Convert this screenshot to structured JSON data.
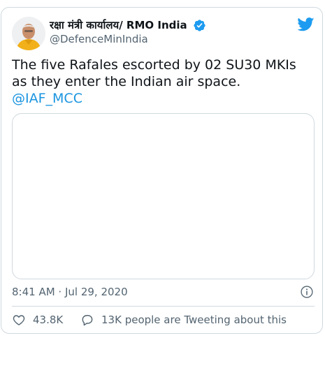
{
  "author": {
    "display_name": "रक्षा मंत्री कार्यालय/ RMO India",
    "handle": "@DefenceMinIndia",
    "verified": true
  },
  "tweet": {
    "text": "The five Rafales escorted by 02 SU30 MKIs as they enter the Indian air space.",
    "mention": "@IAF_MCC"
  },
  "meta": {
    "timestamp": "8:41 AM · Jul 29, 2020"
  },
  "actions": {
    "like_count": "43.8K",
    "tweeting_about": "13K people are Tweeting about this"
  },
  "icons": {
    "brand": "twitter-bird-icon",
    "verified": "verified-badge-icon",
    "info": "info-icon",
    "like": "heart-icon",
    "reply": "speech-bubble-icon"
  },
  "colors": {
    "brand_blue": "#1d9bf0",
    "link_blue": "#1b95e0",
    "secondary_text": "#536471",
    "border": "#cfd9de"
  }
}
